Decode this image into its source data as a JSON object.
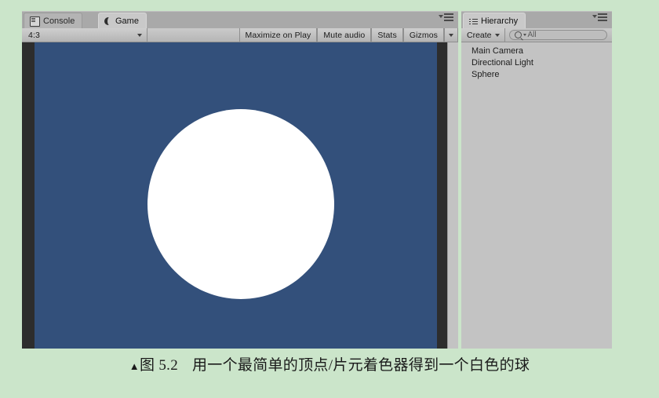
{
  "page": {
    "background_color": "#cbe5ca"
  },
  "game_panel": {
    "tabs": [
      {
        "label": "Console",
        "icon": "console-icon",
        "active": false
      },
      {
        "label": "Game",
        "icon": "game-view-icon",
        "active": true
      }
    ],
    "menu_icon": "panel-menu-icon",
    "toolbar": {
      "aspect_ratio": "4:3",
      "aspect_dropdown_icon": "chevron-down-icon",
      "maximize_on_play": "Maximize on Play",
      "mute_audio": "Mute audio",
      "stats": "Stats",
      "gizmos": "Gizmos",
      "gizmos_dropdown_icon": "chevron-down-icon"
    },
    "render": {
      "background_color": "#33507b",
      "letterbox_color": "#2d2d2d",
      "object_color": "#ffffff",
      "object_shape": "sphere"
    }
  },
  "hierarchy_panel": {
    "tab": {
      "label": "Hierarchy",
      "icon": "hierarchy-icon",
      "active": true
    },
    "menu_icon": "panel-menu-icon",
    "toolbar": {
      "create_label": "Create",
      "create_dropdown_icon": "chevron-down-icon",
      "search_icon": "search-icon",
      "search_filter_icon": "chevron-down-icon",
      "search_value": "All"
    },
    "items": [
      {
        "label": "Main Camera"
      },
      {
        "label": "Directional Light"
      },
      {
        "label": "Sphere"
      }
    ]
  },
  "caption": {
    "marker": "▲",
    "figure_label": "图",
    "figure_number": "5.2",
    "text": "用一个最简单的顶点/片元着色器得到一个白色的球"
  }
}
